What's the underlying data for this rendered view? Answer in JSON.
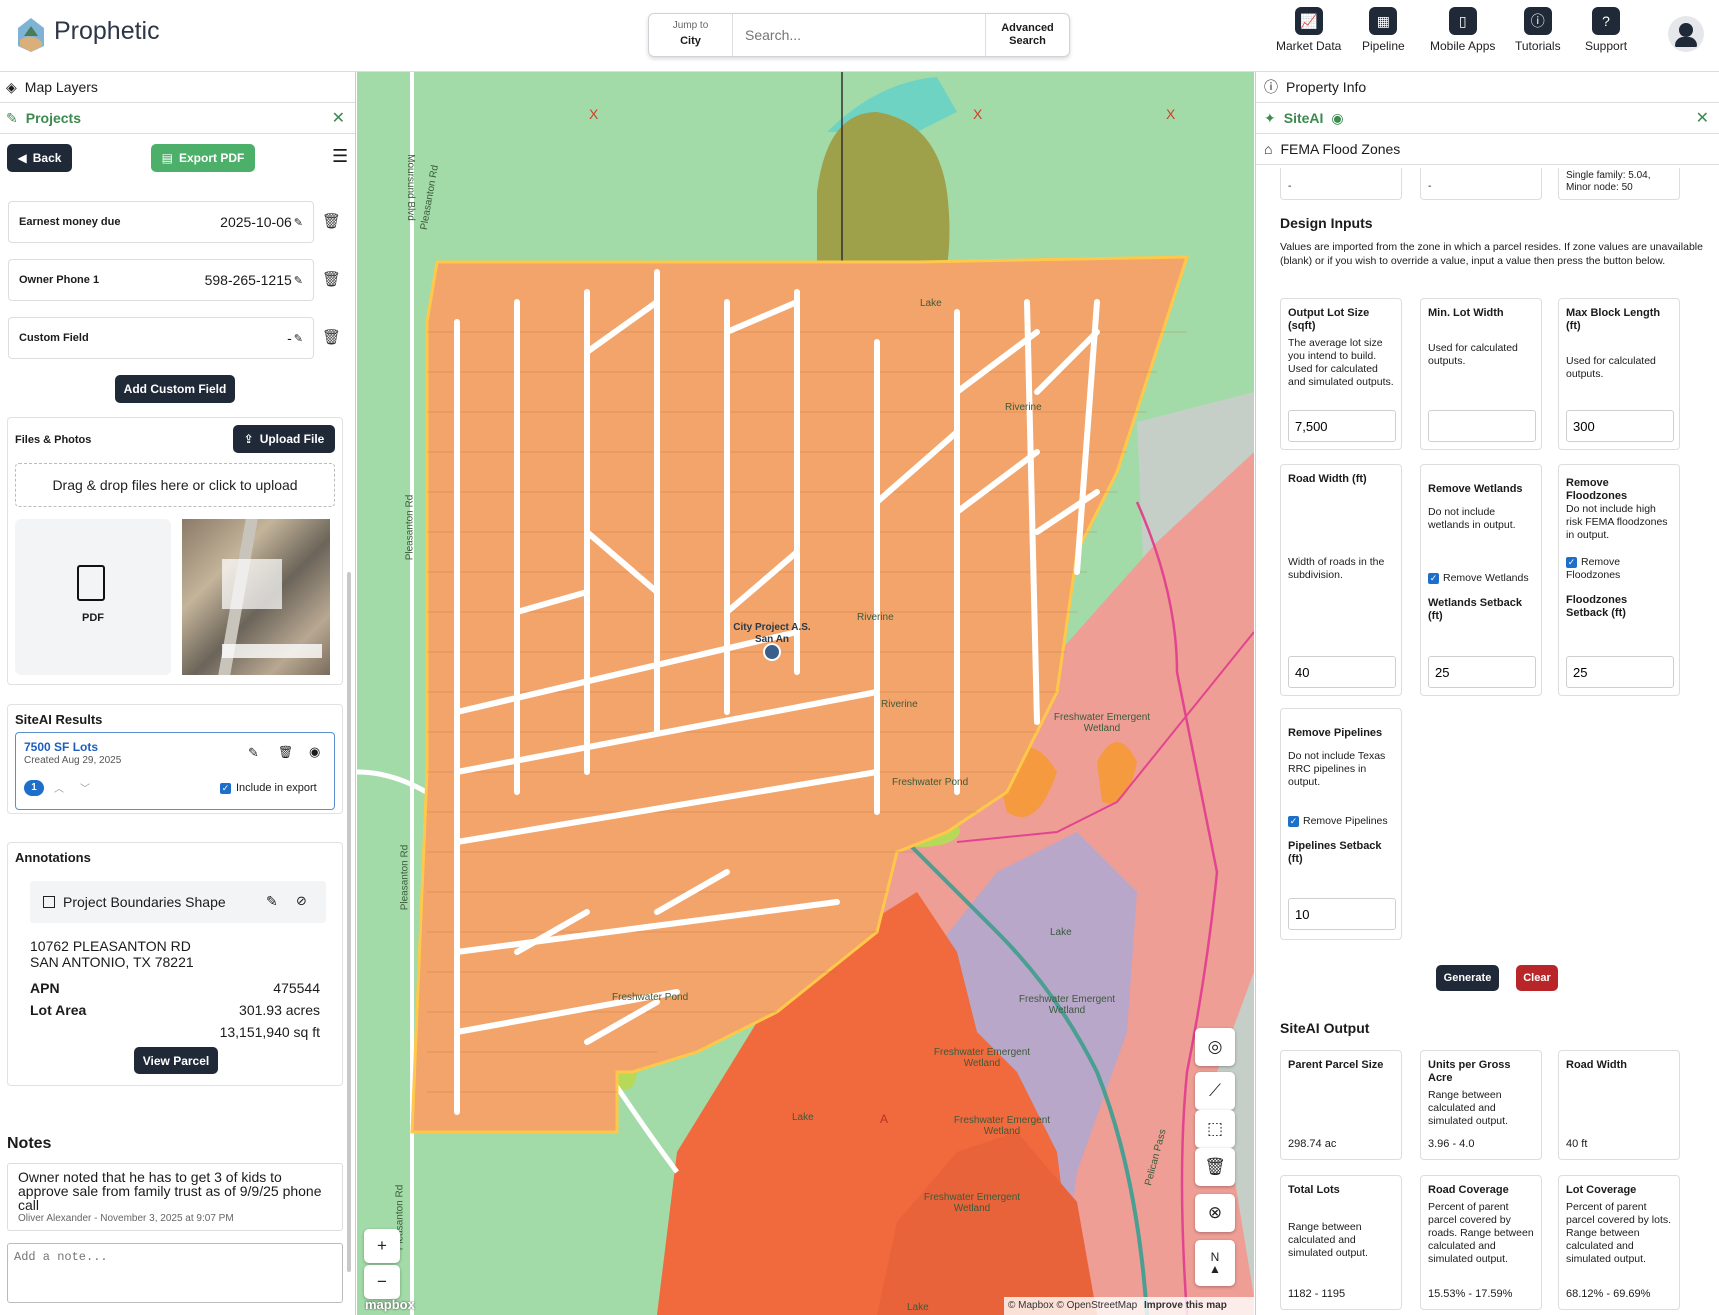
{
  "brand": {
    "name": "Prophetic"
  },
  "search": {
    "jump_small": "Jump to",
    "jump_value": "City",
    "placeholder": "Search...",
    "advanced": "Advanced Search"
  },
  "nav": [
    "Market Data",
    "Pipeline",
    "Mobile Apps",
    "Tutorials",
    "Support"
  ],
  "left": {
    "map_layers": "Map Layers",
    "projects": "Projects",
    "back": "Back",
    "export_pdf": "Export PDF",
    "fields": [
      {
        "label": "Earnest money due",
        "value": "2025-10-06"
      },
      {
        "label": "Owner Phone 1",
        "value": "598-265-1215"
      },
      {
        "label": "Custom Field",
        "value": "-"
      }
    ],
    "add_custom_field": "Add Custom Field",
    "files_title": "Files & Photos",
    "upload_file": "Upload File",
    "drop_text": "Drag & drop files here or click to upload",
    "pdf_label": "PDF",
    "siteai_results_title": "SiteAI Results",
    "result_name": "7500 SF Lots",
    "result_created": "Created Aug 29, 2025",
    "result_badge": "1",
    "include_export": "Include in export",
    "annotations_title": "Annotations",
    "annotation_name": "Project Boundaries Shape",
    "address1": "10762 PLEASANTON RD",
    "address2": "SAN ANTONIO, TX 78221",
    "apn_label": "APN",
    "apn_value": "475544",
    "lot_area_label": "Lot Area",
    "lot_area_acres": "301.93 acres",
    "lot_area_sqft": "13,151,940 sq ft",
    "view_parcel": "View Parcel",
    "notes_title": "Notes",
    "note_text": "Owner noted that he has to get 3 of kids to approve sale from family trust as of 9/9/25 phone call",
    "note_meta": "Oliver Alexander - November 3, 2025 at 9:07 PM",
    "note_placeholder": "Add a note..."
  },
  "map": {
    "labels": [
      "Moursund Blvd",
      "Pleasanton Rd",
      "Pleasanton Rd",
      "Pleasanton Rd",
      "Pleasanton Rd",
      "Lake",
      "Riverine",
      "Riverine",
      "Riverine",
      "Freshwater Emergent Wetland",
      "Freshwater Pond",
      "Freshwater Pond",
      "Lake",
      "Freshwater Emergent Wetland",
      "Freshwater Emergent Wetland",
      "Lake",
      "Freshwater Emergent Wetland",
      "Freshwater Emergent Wetland",
      "Lake",
      "Pelican Pass",
      "A",
      "X",
      "X",
      "X"
    ],
    "pin_label": "City Project A.S. San An",
    "attribution": "© Mapbox © OpenStreetMap",
    "improve": "Improve this map",
    "mapbox": "mapbox"
  },
  "right": {
    "property_info": "Property Info",
    "siteai": "SiteAI",
    "fema": "FEMA Flood Zones",
    "top_vals": [
      "-",
      "-",
      "Single family: 5.04, Minor node: 50"
    ],
    "design_title": "Design Inputs",
    "design_desc": "Values are imported from the zone in which a parcel resides. If zone values are unavailable (blank) or if you wish to override a value, input a value then press the button below.",
    "inputs": [
      {
        "title": "Output Lot Size (sqft)",
        "desc": "The average lot size you intend to build. Used for calculated and simulated outputs.",
        "value": "7,500"
      },
      {
        "title": "Min. Lot Width",
        "desc": "Used for calculated outputs.",
        "value": ""
      },
      {
        "title": "Max Block Length (ft)",
        "desc": "Used for calculated outputs.",
        "value": "300"
      },
      {
        "title": "Road Width (ft)",
        "desc": "Width of roads in the subdivision.",
        "value": "40"
      },
      {
        "title": "Remove Wetlands",
        "desc": "Do not include wetlands in output.",
        "check": "Remove Wetlands",
        "sub": "Wetlands Setback (ft)",
        "value": "25"
      },
      {
        "title": "Remove Floodzones",
        "desc": "Do not include high risk FEMA floodzones in output.",
        "check": "Remove Floodzones",
        "sub": "Floodzones Setback (ft)",
        "value": "25"
      },
      {
        "title": "Remove Pipelines",
        "desc": "Do not include Texas RRC pipelines in output.",
        "check": "Remove Pipelines",
        "sub": "Pipelines Setback (ft)",
        "value": "10"
      }
    ],
    "generate": "Generate",
    "clear": "Clear",
    "output_title": "SiteAI Output",
    "outputs": [
      {
        "title": "Parent Parcel Size",
        "desc": "",
        "value": "298.74 ac"
      },
      {
        "title": "Units per Gross Acre",
        "desc": "Range between calculated and simulated output.",
        "value": "3.96 - 4.0"
      },
      {
        "title": "Road Width",
        "desc": "",
        "value": "40 ft"
      },
      {
        "title": "Total Lots",
        "desc": "Range between calculated and simulated output.",
        "value": "1182 - 1195"
      },
      {
        "title": "Road Coverage",
        "desc": "Percent of parent parcel covered by roads. Range between calculated and simulated output.",
        "value": "15.53% - 17.59%"
      },
      {
        "title": "Lot Coverage",
        "desc": "Percent of parent parcel covered by lots. Range between calculated and simulated output.",
        "value": "68.12% - 69.69%"
      }
    ]
  }
}
